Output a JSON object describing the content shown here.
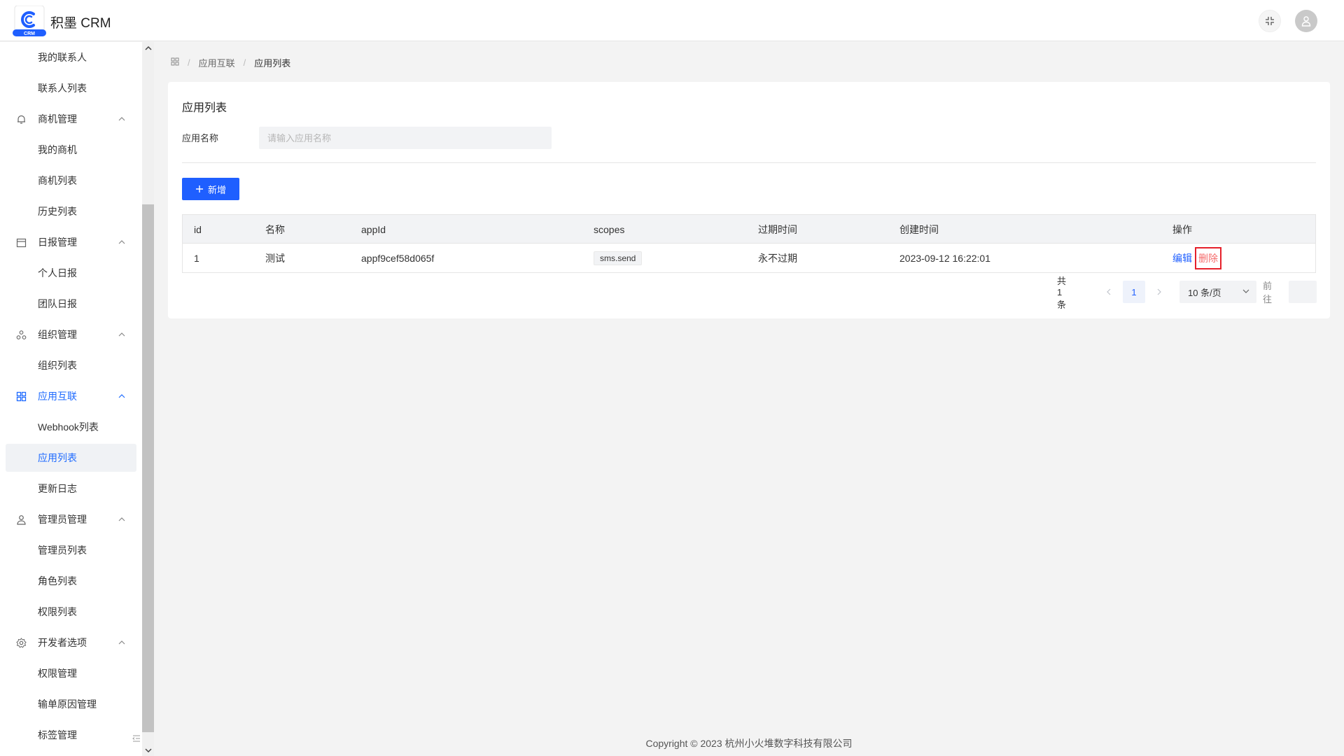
{
  "header": {
    "app_title": "积墨 CRM",
    "logo_text": "CRM"
  },
  "sidebar": {
    "items": [
      {
        "label": "我的联系人",
        "type": "sub"
      },
      {
        "label": "联系人列表",
        "type": "sub"
      },
      {
        "label": "商机管理",
        "type": "group",
        "icon": "bell-icon"
      },
      {
        "label": "我的商机",
        "type": "sub"
      },
      {
        "label": "商机列表",
        "type": "sub"
      },
      {
        "label": "历史列表",
        "type": "sub"
      },
      {
        "label": "日报管理",
        "type": "group",
        "icon": "calendar-icon"
      },
      {
        "label": "个人日报",
        "type": "sub"
      },
      {
        "label": "团队日报",
        "type": "sub"
      },
      {
        "label": "组织管理",
        "type": "group",
        "icon": "organization-icon"
      },
      {
        "label": "组织列表",
        "type": "sub"
      },
      {
        "label": "应用互联",
        "type": "group",
        "icon": "grid-icon",
        "highlight": true
      },
      {
        "label": "Webhook列表",
        "type": "sub"
      },
      {
        "label": "应用列表",
        "type": "sub",
        "active": true
      },
      {
        "label": "更新日志",
        "type": "sub"
      },
      {
        "label": "管理员管理",
        "type": "group",
        "icon": "user-icon"
      },
      {
        "label": "管理员列表",
        "type": "sub"
      },
      {
        "label": "角色列表",
        "type": "sub"
      },
      {
        "label": "权限列表",
        "type": "sub"
      },
      {
        "label": "开发者选项",
        "type": "group",
        "icon": "gear-icon"
      },
      {
        "label": "权限管理",
        "type": "sub"
      },
      {
        "label": "输单原因管理",
        "type": "sub"
      },
      {
        "label": "标签管理",
        "type": "sub"
      }
    ]
  },
  "breadcrumb": {
    "items": [
      "应用互联",
      "应用列表"
    ]
  },
  "card": {
    "title": "应用列表",
    "filter_label": "应用名称",
    "filter_placeholder": "请输入应用名称",
    "add_button": "新增"
  },
  "table": {
    "columns": [
      "id",
      "名称",
      "appId",
      "scopes",
      "过期时间",
      "创建时间",
      "操作"
    ],
    "rows": [
      {
        "id": "1",
        "name": "测试",
        "appId": "appf9cef58d065f",
        "scopes": "sms.send",
        "expire": "永不过期",
        "created": "2023-09-12 16:22:01",
        "edit": "编辑",
        "delete": "删除"
      }
    ]
  },
  "pagination": {
    "total": "共 1 条",
    "current_page": "1",
    "page_size": "10 条/页",
    "goto": "前往"
  },
  "footer": {
    "copyright": "Copyright © 2023 杭州小火堆数字科技有限公司"
  },
  "colors": {
    "primary": "#1f5fff",
    "danger": "#f56c6c",
    "highlight_box": "#e5202a"
  }
}
